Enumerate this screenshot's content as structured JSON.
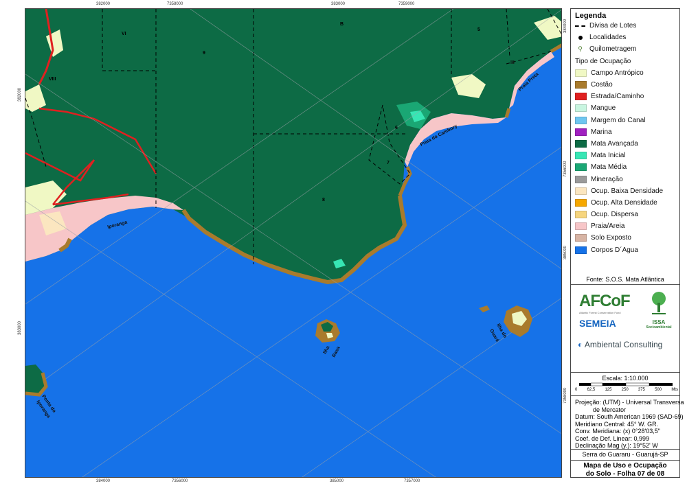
{
  "legend": {
    "title": "Legenda",
    "symbols": [
      {
        "label": "Divisa de Lotes",
        "kind": "dash"
      },
      {
        "label": "Localidades",
        "kind": "dot"
      },
      {
        "label": "Quilometragem",
        "kind": "km"
      }
    ],
    "occupation_title": "Tipo de Ocupação",
    "classes": [
      {
        "label": "Campo Antrópico",
        "color": "#f0f8c4"
      },
      {
        "label": "Costão",
        "color": "#a97b2c"
      },
      {
        "label": "Estrada/Caminho",
        "color": "#e02020"
      },
      {
        "label": "Mangue",
        "color": "#c8f5e0"
      },
      {
        "label": "Margem do Canal",
        "color": "#6ec6f0"
      },
      {
        "label": "Marina",
        "color": "#a020c0"
      },
      {
        "label": "Mata Avançada",
        "color": "#0d6b45"
      },
      {
        "label": "Mata Inicial",
        "color": "#37e6b4"
      },
      {
        "label": "Mata Média",
        "color": "#1aa774"
      },
      {
        "label": "Mineração",
        "color": "#9a9a9a"
      },
      {
        "label": "Ocup. Baixa Densidade",
        "color": "#fbe6c0"
      },
      {
        "label": "Ocup. Alta Densidade",
        "color": "#f6a800"
      },
      {
        "label": "Ocup. Dispersa",
        "color": "#f6d57e"
      },
      {
        "label": "Praia/Areia",
        "color": "#f7c6c8"
      },
      {
        "label": "Solo Exposto",
        "color": "#d7b4a4"
      },
      {
        "label": "Corpos D´Agua",
        "color": "#1672e8"
      }
    ],
    "source": "Fonte: S.O.S. Mata Atlântica"
  },
  "logos": {
    "afcof": "AFCoF",
    "afcof_sub": "Atlantic Forest Conservation Fund",
    "semeia": "SEMEIA",
    "issa": "ISSA",
    "issa_sub": "Socioambiental",
    "ambiental": "Ambiental Consulting"
  },
  "scale": {
    "label": "Escala: 1:10.000",
    "ticks": [
      "0",
      "62,5",
      "125",
      "250",
      "375",
      "500"
    ],
    "unit": "Mts"
  },
  "projection": [
    "Projeção: (UTM) - Universal Transversa",
    "de Mercator",
    "Datum: South American 1969 (SAD-69)",
    "Meridiano Central: 45° W. GR.",
    "Conv. Meridiana: (x) 0°28'03,5\"",
    "Coef. de Def. Linear: 0,999",
    "Declinação Mag (y.): 19°52' W"
  ],
  "location": "Serra do Guararu - Guarujá-SP",
  "title_line1": "Mapa de Uso e Ocupação",
  "title_line2": "do Solo - Folha 07 de 08",
  "map": {
    "top_ticks": [
      "382000",
      "7358000",
      "383000",
      "7359000"
    ],
    "bottom_ticks": [
      "384000",
      "7356000",
      "385000",
      "7357000"
    ],
    "left_ticks": [
      "382000",
      "383000"
    ],
    "right_ticks": [
      "384000",
      "7356000",
      "385000",
      "7358000"
    ],
    "lot_labels": [
      "VI",
      "9",
      "B",
      "5",
      "VIII",
      "6",
      "7",
      "8"
    ],
    "place_labels": {
      "iporanga": "Iporanga",
      "praia_cambury": "Praia do Cambury",
      "praia_preta": "Praia Preta",
      "ilha_rasa_1": "Ilha",
      "ilha_rasa_2": "Rasa",
      "ilha_guara_1": "Ilha do",
      "ilha_guara_2": "Guará",
      "ponta_1": "Ponta do",
      "ponta_2": "Iporanga",
      "km": "III"
    }
  }
}
